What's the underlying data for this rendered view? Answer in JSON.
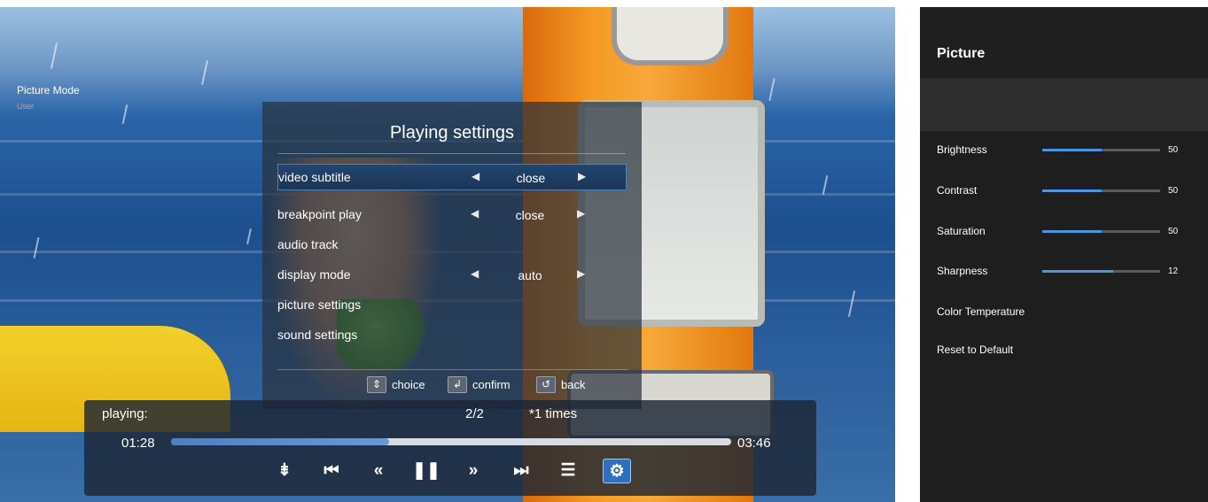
{
  "dialog": {
    "title": "Playing settings",
    "options": [
      {
        "label": "video subtitle",
        "value": "close",
        "has_arrows": true,
        "selected": true
      },
      {
        "label": "breakpoint play",
        "value": "close",
        "has_arrows": true,
        "selected": false
      },
      {
        "label": "audio track",
        "value": "",
        "has_arrows": false,
        "selected": false
      },
      {
        "label": "display mode",
        "value": "auto",
        "has_arrows": true,
        "selected": false
      },
      {
        "label": "picture settings",
        "value": "",
        "has_arrows": false,
        "selected": false
      },
      {
        "label": "sound settings",
        "value": "",
        "has_arrows": false,
        "selected": false
      }
    ],
    "hints": {
      "choice": "choice",
      "confirm": "confirm",
      "back": "back"
    }
  },
  "player": {
    "status_label": "playing:",
    "index": "2/2",
    "speed": "*1 times",
    "time_current": "01:28",
    "time_total": "03:46",
    "progress": 0.39,
    "controls": [
      {
        "name": "playlist-order",
        "glyph": "⇟"
      },
      {
        "name": "skip-previous",
        "glyph": "⏮"
      },
      {
        "name": "rewind",
        "glyph": "«"
      },
      {
        "name": "pause",
        "glyph": "❚❚"
      },
      {
        "name": "fast-forward",
        "glyph": "»"
      },
      {
        "name": "skip-next",
        "glyph": "⏭"
      },
      {
        "name": "list",
        "glyph": "☰"
      },
      {
        "name": "settings",
        "glyph": "⚙"
      }
    ]
  },
  "panel": {
    "title": "Picture",
    "picture_mode": {
      "label": "Picture Mode",
      "value": "User"
    },
    "sliders": [
      {
        "label": "Brightness",
        "value": "50",
        "level": 0.5
      },
      {
        "label": "Contrast",
        "value": "50",
        "level": 0.5
      },
      {
        "label": "Saturation",
        "value": "50",
        "level": 0.5
      },
      {
        "label": "Sharpness",
        "value": "12",
        "level": 0.6
      }
    ],
    "color_temperature": "Color Temperature",
    "reset": "Reset to Default"
  },
  "colors": {
    "accent": "#4a94e0",
    "dialog_bg": "#28303a",
    "panel_bg": "#1e1e1e"
  }
}
